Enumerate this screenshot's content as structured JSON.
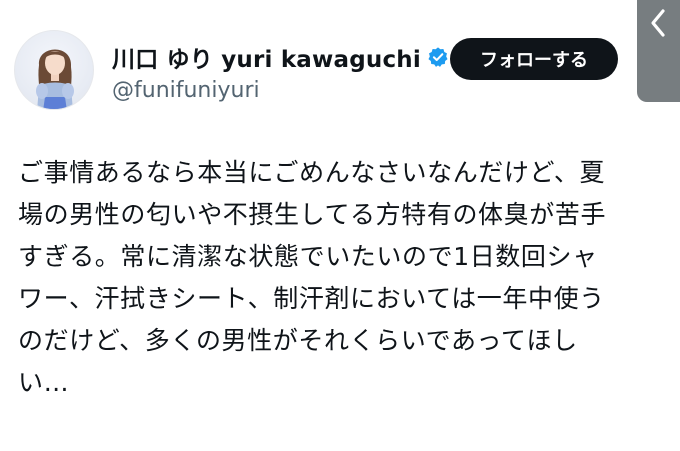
{
  "profile": {
    "display_name": "川口 ゆり yuri kawaguchi",
    "handle": "@funifuniyuri",
    "verified_icon": "verified-badge-icon",
    "follow_label": "フォローする"
  },
  "tweet": {
    "lines": [
      "ご事情あるなら本当にごめんなさいなんだけど、夏",
      "場の男性の匂いや不摂生してる方特有の体臭が苦手",
      "すぎる。常に清潔な状態でいたいので1日数回シャ",
      "ワー、汗拭きシート、制汗剤においては一年中使う",
      "のだけど、多くの男性がそれくらいであってほし",
      "い…"
    ]
  },
  "colors": {
    "text": "#0f1419",
    "secondary_text": "#536471",
    "follow_button_bg": "#0f1419",
    "verified_blue": "#1d9bf0",
    "side_panel": "#777d80"
  }
}
